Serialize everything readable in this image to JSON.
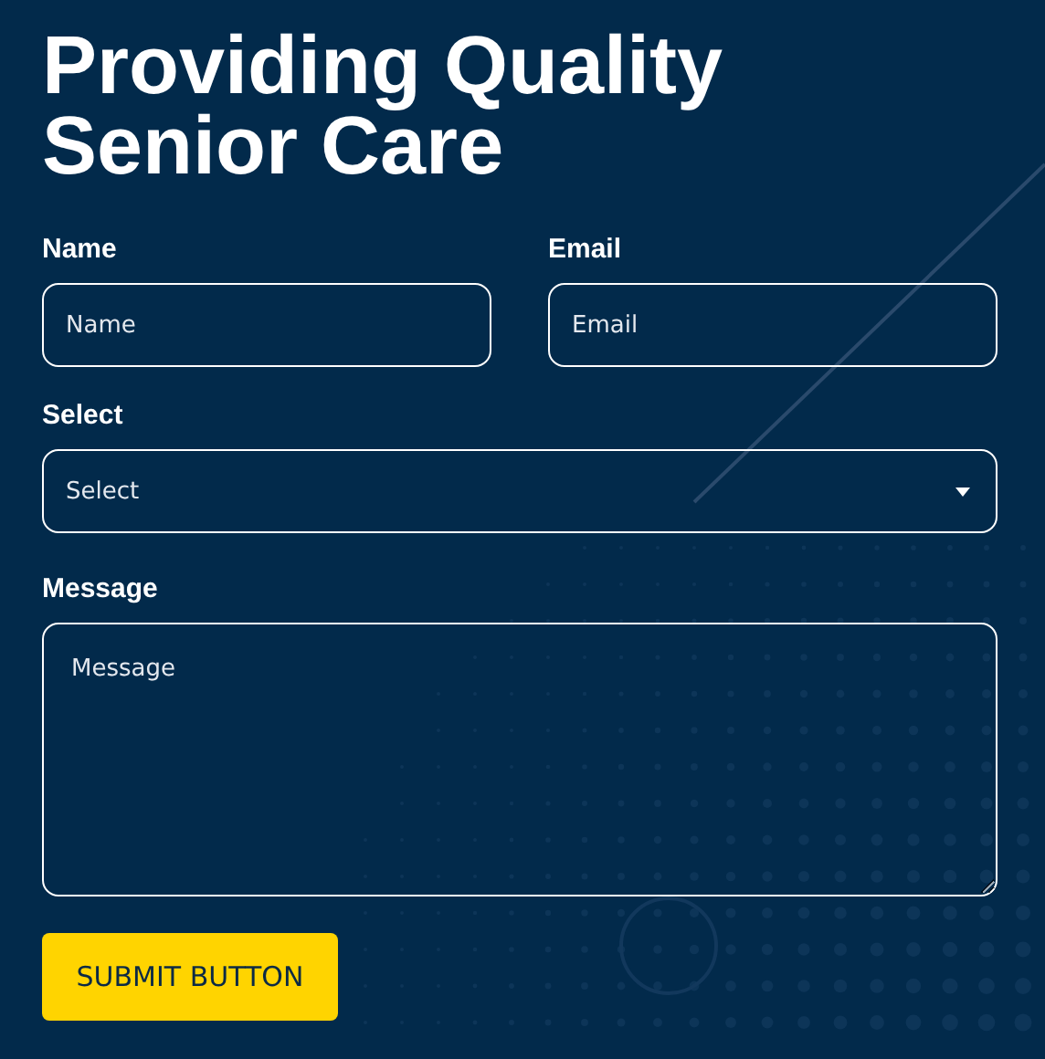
{
  "heading": "Providing Quality Senior Care",
  "fields": [
    {
      "label": "Name",
      "placeholder": "Name",
      "kind": "text"
    },
    {
      "label": "Email",
      "placeholder": "Email",
      "kind": "text"
    },
    {
      "label": "Select",
      "placeholder": "Select",
      "kind": "select"
    },
    {
      "label": "Message",
      "placeholder": "Message",
      "kind": "textarea"
    }
  ],
  "submit": "SUBMIT BUTTON"
}
